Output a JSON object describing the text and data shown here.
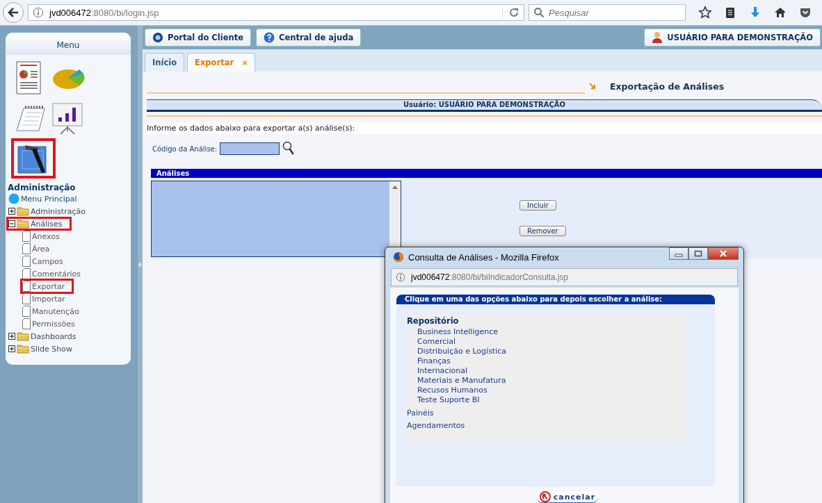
{
  "browser": {
    "url_host": "jvd006472",
    "url_path": ":8080/bi/login.jsp",
    "search": {
      "placeholder": "Pesquisar"
    }
  },
  "sidebar": {
    "title": "Menu",
    "icons": [
      {
        "kind": "report",
        "highlighted": false
      },
      {
        "kind": "pie",
        "highlighted": false
      },
      {
        "kind": "calendar",
        "highlighted": false
      },
      {
        "kind": "presentation",
        "highlighted": false
      },
      {
        "kind": "tools",
        "highlighted": true
      }
    ],
    "section": "Administração",
    "tree": [
      {
        "label": "Menu Principal",
        "kind": "globe"
      },
      {
        "label": "Administração",
        "kind": "folder",
        "expanded": false,
        "highlighted": false
      },
      {
        "label": "Análises",
        "kind": "folder",
        "expanded": true,
        "highlighted": true,
        "children": [
          {
            "label": "Anexos",
            "highlighted": false
          },
          {
            "label": "Área",
            "highlighted": false
          },
          {
            "label": "Campos",
            "highlighted": false
          },
          {
            "label": "Comentários",
            "highlighted": false
          },
          {
            "label": "Exportar",
            "highlighted": true
          },
          {
            "label": "Importar",
            "highlighted": false
          },
          {
            "label": "Manutenção",
            "highlighted": false
          },
          {
            "label": "Permissões",
            "highlighted": false
          }
        ]
      },
      {
        "label": "Dashboards",
        "kind": "folder",
        "expanded": false,
        "highlighted": false
      },
      {
        "label": "Slide Show",
        "kind": "folder",
        "expanded": false,
        "highlighted": false
      }
    ]
  },
  "topbar": {
    "buttons": [
      {
        "label": "Portal do Cliente",
        "kind": "portal"
      },
      {
        "label": "Central de ajuda",
        "kind": "help"
      }
    ],
    "user": "USUÁRIO PARA DEMONSTRAÇÃO"
  },
  "tabs": [
    {
      "label": "Início",
      "selected": false,
      "closable": false
    },
    {
      "label": "Exportar",
      "selected": true,
      "closable": true,
      "close": "✖"
    }
  ],
  "page": {
    "title": "Exportação de Análises",
    "user_band": "Usuário: USUÁRIO PARA DEMONSTRAÇÃO",
    "intro": "Informe os dados abaixo para exportar a(s) análise(s):",
    "code_label": "Código da Análise:",
    "list_title": "Análises",
    "buttons": [
      "Incluir",
      "Remover"
    ]
  },
  "popup": {
    "title": "Consulta de Análises - Mozilla Firefox",
    "url_host": "jvd006472",
    "url_path": ":8080/bi/biIndicadorConsulta.jsp",
    "header": "Clique em uma das opções abaixo para depois escolher a análise:",
    "groups": [
      {
        "label": "Repositório",
        "kind": "heading",
        "children": [
          "Business Intelligence",
          "Comercial",
          "Distribuição e Logística",
          "Finanças",
          "Internacional",
          "Materiais e Manufatura",
          "Recusos Humanos",
          "Teste Suporte BI"
        ]
      },
      {
        "label": "Painéis",
        "kind": "link"
      },
      {
        "label": "Agendamentos",
        "kind": "link"
      }
    ],
    "cancel": "cancelar"
  }
}
